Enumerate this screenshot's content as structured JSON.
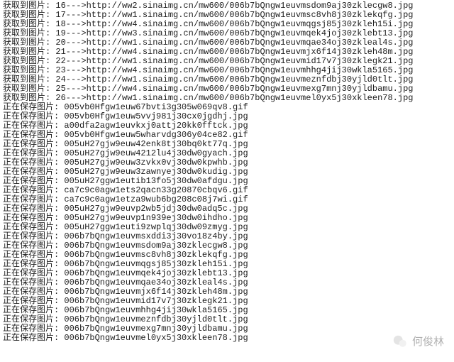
{
  "labels": {
    "fetch_prefix": "获取到图片:",
    "save_prefix": "正在保存图片:",
    "arrow": "--->"
  },
  "watermark": {
    "text": "何俊林"
  },
  "fetch_lines": [
    {
      "n": "16",
      "url": "http://ww2.sinaimg.cn/mw600/006b7bQngw1euvmsdom9aj30zklecgw8.jpg"
    },
    {
      "n": "17",
      "url": "http://ww1.sinaimg.cn/mw600/006b7bQngw1euvmsc8vh8j30zklekqfg.jpg"
    },
    {
      "n": "18",
      "url": "http://ww4.sinaimg.cn/mw600/006b7bQngw1euvmqgsj85j30zkleh15i.jpg"
    },
    {
      "n": "19",
      "url": "http://ww3.sinaimg.cn/mw600/006b7bQngw1euvmqek4joj30zklebt13.jpg"
    },
    {
      "n": "20",
      "url": "http://ww1.sinaimg.cn/mw600/006b7bQngw1euvmqae34oj30zkleal4s.jpg"
    },
    {
      "n": "21",
      "url": "http://ww4.sinaimg.cn/mw600/006b7bQngw1euvmjx6f14j30zkleh48m.jpg"
    },
    {
      "n": "22",
      "url": "http://ww1.sinaimg.cn/mw600/006b7bQngw1euvmid17v7j30zklegk21.jpg"
    },
    {
      "n": "23",
      "url": "http://ww4.sinaimg.cn/mw600/006b7bQngw1euvmhhg4jij30wkla5165.jpg"
    },
    {
      "n": "24",
      "url": "http://ww1.sinaimg.cn/mw600/006b7bQngw1euvmeznfdbj30yjld0tlt.jpg"
    },
    {
      "n": "25",
      "url": "http://ww4.sinaimg.cn/mw600/006b7bQngw1euvmexg7mnj30yjldbamu.jpg"
    },
    {
      "n": "26",
      "url": "http://ww1.sinaimg.cn/mw600/006b7bQngw1euvmel0yx5j30xkleen78.jpg"
    }
  ],
  "save_lines": [
    "005vb0Hfgw1euw67bvti3g305w069qv8.gif",
    "005vb0Hfgw1euw5vvj981j30cx0jgdhj.jpg",
    "a00dfa2agw1euvkxj0attj20kk0fftck.jpg",
    "005vb0Hfgw1euw5wharvdg306y04ce82.gif",
    "005uH27gjw9euw42enk8tj30bq0kt77q.jpg",
    "005uH27gjw9euw4212lu4j30dw0gyach.jpg",
    "005uH27gjw9euw3zvkx0vj30dw0kpwhb.jpg",
    "005uH27gjw9euw3zawnyej30dw0kudig.jpg",
    "005uH27ggw1eutib13fo5j30dw0afdgu.jpg",
    "ca7c9c0agw1ets2qacn33g20870cbqv6.gif",
    "ca7c9c0agw1etza9wub6bg208c08j7wi.gif",
    "005uH27gjw9euvp2wb5jdj30dw0adq5c.jpg",
    "005uH27gjw9euvp1n939ej30dw0ihdho.jpg",
    "005uH27ggw1euti9zwplqj30dw09zmyg.jpg",
    "006b7bQngw1euvmsxddi3j30vo18z4by.jpg",
    "006b7bQngw1euvmsdom9aj30zklecgw8.jpg",
    "006b7bQngw1euvmsc8vh8j30zklekqfg.jpg",
    "006b7bQngw1euvmqgsj85j30zkleh15i.jpg",
    "006b7bQngw1euvmqek4joj30zklebt13.jpg",
    "006b7bQngw1euvmqae34oj30zkleal4s.jpg",
    "006b7bQngw1euvmjx6f14j30zkleh48m.jpg",
    "006b7bQngw1euvmid17v7j30zklegk21.jpg",
    "006b7bQngw1euvmhhg4jij30wkla5165.jpg",
    "006b7bQngw1euvmeznfdbj30yjld0tlt.jpg",
    "006b7bQngw1euvmexg7mnj30yjldbamu.jpg",
    "006b7bQngw1euvmel0yx5j30xkleen78.jpg"
  ]
}
